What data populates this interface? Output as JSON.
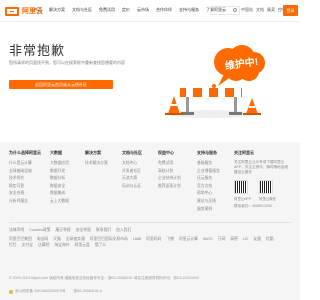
{
  "nav": {
    "logo_text": "阿里云",
    "links": [
      "产品",
      "解决方案",
      "文档与社区",
      "免费试用",
      "定价",
      "云市场",
      "合作伙伴",
      "支持与服务",
      "了解阿里云"
    ],
    "right": [
      "中国站",
      "文档",
      "备案",
      "控制台"
    ],
    "signin": "登录"
  },
  "hero": {
    "title": "非常抱歉",
    "desc": "您所请求的页面找不到，您可以在搜索框中重新查找您想要的内容",
    "button": "返回阿里云首页或从云栖社区"
  },
  "illustration": {
    "cloud_text": "维护中!",
    "accent": "#ff6a00"
  },
  "footer": {
    "columns": [
      {
        "title": "为什么选择阿里云",
        "items": [
          "什么是云计算",
          "全球基础设施",
          "技术领先",
          "稳定可靠",
          "安全合规",
          "分析师报告"
        ]
      },
      {
        "title": "大数据",
        "items": [
          "大数据应用",
          "数据开发",
          "数据分析",
          "数据安全",
          "数据集成",
          "云上大数据"
        ]
      },
      {
        "title": "解决方案",
        "items": [
          "技术解决方案"
        ]
      },
      {
        "title": "文档与社区",
        "items": [
          "文档中心",
          "开发者社区",
          "天池大赛",
          "培训与认证"
        ]
      },
      {
        "title": "权益中心",
        "items": [
          "免费试用",
          "高校计划",
          "企业扶持计划",
          "推荐返现计划"
        ]
      },
      {
        "title": "支持与服务",
        "items": [
          "基础服务",
          "企业增值服务",
          "迁云服务",
          "官方文档",
          "帮助中心",
          "建议与反馈",
          "服务案例"
        ]
      }
    ],
    "follow": {
      "title": "关注阿里云",
      "desc": "关注阿里云公众号或下载阿里云APP，关注云资讯，随时随地运维管控云服务",
      "qr_labels": [
        "阿里云APP",
        "阿里云微信"
      ],
      "phone": "联系我们：4008013260"
    },
    "links_row1": [
      "法律声明",
      "Cookies政策",
      "廉正举报",
      "安全举报",
      "联系我们",
      "加入我们"
    ],
    "links_row2": [
      "阿里巴巴集团",
      "淘宝网",
      "天猫",
      "全球速卖通",
      "阿里巴巴国际交易市场",
      "1688",
      "阿里妈妈",
      "飞猪",
      "阿里云计算",
      "AliOS",
      "万网",
      "高德",
      "UC",
      "友盟",
      "优酷",
      "钉钉",
      "支付宝",
      "达摩院",
      "淘宝海外",
      "阿里云盘",
      "饿了么"
    ],
    "copyright": "© 2009-2024 Aliyun.com 版权所有 增值电信业务经营许可证：浙B2-20080101 域名注册服务机构许可：浙D3-20210002",
    "badges": [
      "浙公网安备 33010602009975号",
      "浙B2-20080101-4"
    ]
  }
}
